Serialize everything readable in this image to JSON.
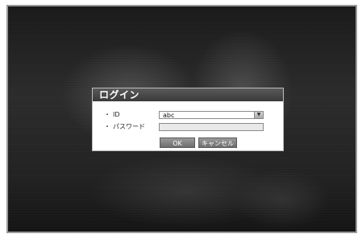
{
  "dialog": {
    "title": "ログイン",
    "id_label": "ID",
    "id_value": "abc",
    "password_label": "パスワード",
    "password_value": "",
    "bullet": "・",
    "ok_label": "OK",
    "cancel_label": "キャンセル"
  },
  "icons": {
    "dropdown": "chevron-down-icon"
  },
  "colors": {
    "titlebar": "#4a4a4a",
    "button": "#808080",
    "background": "#222222"
  }
}
